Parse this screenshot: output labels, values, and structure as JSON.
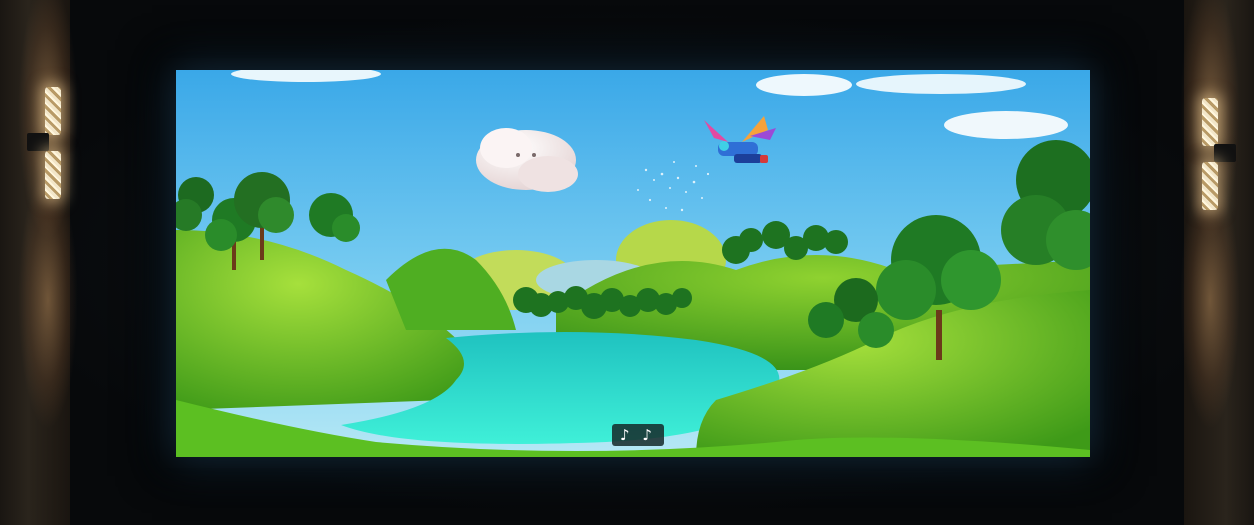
{
  "scene": {
    "subtitle_symbol": "♪ ♪"
  },
  "colors": {
    "sky_top": "#3fb0ea",
    "sky_bottom": "#a9e4f7",
    "grass_light": "#9bd63a",
    "grass_dark": "#3d9a1a",
    "water": "#2fd6c9",
    "tree_dark": "#1f6e1f",
    "sconce_glow": "#ffd9a0"
  }
}
